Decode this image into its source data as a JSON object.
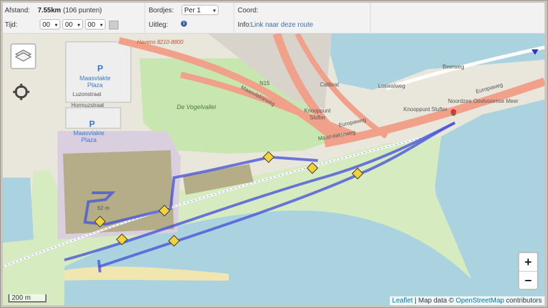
{
  "toolbar": {
    "distance_label": "Afstand:",
    "distance_value": "7.55km",
    "distance_points": "(106 punten)",
    "time_label": "Tijd:",
    "time_h": "00",
    "time_m": "00",
    "time_s": "00",
    "signs_label": "Bordjes:",
    "signs_value": "Per 1",
    "explain_label": "Uitleg:",
    "coord_label": "Coord:",
    "info_label": "Info:",
    "info_link": "Link naar deze route"
  },
  "map": {
    "labels": {
      "havens": "Havens 8210-8800",
      "n15": "N15",
      "maasvlakteweg1": "Maasvlakteweg",
      "maasvlakteweg2": "Maasvlakteweg",
      "europaweg1": "Europaweg",
      "europaweg2": "Europaweg",
      "knooppunt1": "Knooppunt",
      "knooppunt1b": "Slufter",
      "knooppunt2": "Knooppunt Slufter",
      "vogelvallei": "De Vogelvallei",
      "hormuzstraat": "Hormuzstraat",
      "luzonstraat": "Luzonstraat",
      "hormuzstraat_v": "Hormuzstraat",
      "maasvlakte_plaza1": "Maasvlakte\nPlaza",
      "maasvlakte_plaza2": "Maasvlakte\nPlaza",
      "parking_p": "P",
      "loswalweg": "Loswalweg",
      "beerweg": "Beerweg",
      "noordzee": "Noordzee Oostvoornse Meer",
      "calibrat": "Calibrat",
      "height": "62 m"
    },
    "markers": [
      "1",
      "2",
      "3",
      "4",
      "5",
      "6",
      "7"
    ],
    "attribution_leaflet": "Leaflet",
    "attribution_mid": " | Map data © ",
    "attribution_osm": "OpenStreetMap",
    "attribution_end": " contributors",
    "scale": "200 m",
    "zoom_in": "+",
    "zoom_out": "−"
  }
}
